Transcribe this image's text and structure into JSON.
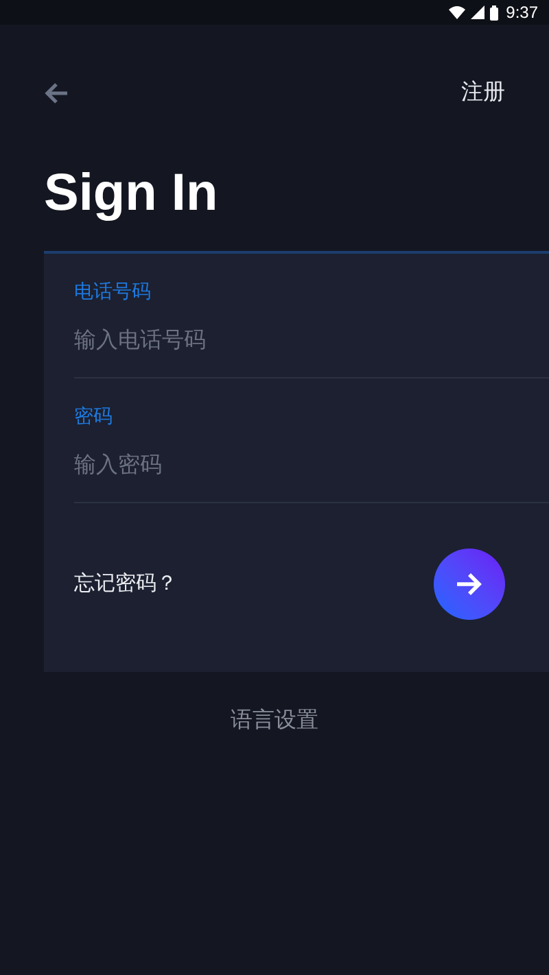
{
  "status_bar": {
    "time": "9:37"
  },
  "header": {
    "action": "注册"
  },
  "title": "Sign In",
  "form": {
    "fields": [
      {
        "label": "电话号码",
        "placeholder": "输入电话号码"
      },
      {
        "label": "密码",
        "placeholder": "输入密码"
      }
    ],
    "forgot_link": "忘记密码？"
  },
  "language_link": "语言设置"
}
